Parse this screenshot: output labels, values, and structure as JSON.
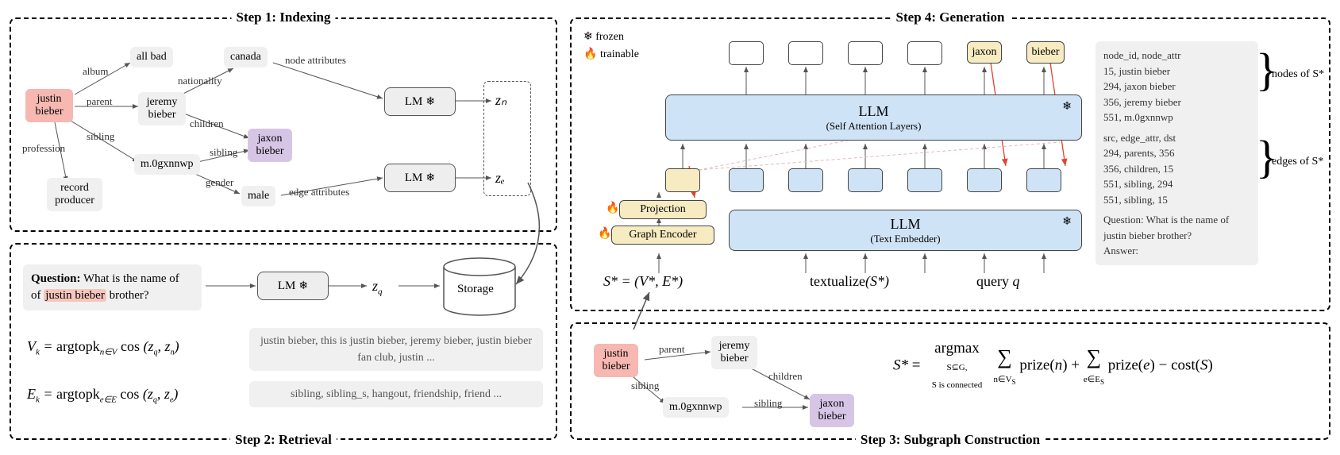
{
  "steps": {
    "s1": "Step 1: Indexing",
    "s2": "Step 2: Retrieval",
    "s3": "Step 3: Subgraph Construction",
    "s4": "Step 4: Generation"
  },
  "legend": {
    "frozen": "frozen",
    "trainable": "trainable"
  },
  "s1": {
    "nodes": {
      "justin": "justin\nbieber",
      "allbad": "all bad",
      "jeremy": "jeremy\nbieber",
      "canada": "canada",
      "jaxon": "jaxon\nbieber",
      "m0": "m.0gxnnwp",
      "record": "record\nproducer",
      "male": "male"
    },
    "edges": {
      "album": "album",
      "parent": "parent",
      "profession": "profession",
      "sibling": "sibling",
      "nationality": "nationality",
      "children": "children",
      "gender": "gender",
      "nodeattr": "node attributes",
      "edgeattr": "edge attributes"
    },
    "lm": "LM",
    "zn": "zₙ",
    "ze": "zₑ"
  },
  "s2": {
    "question_label": "Question:",
    "question_text": " What is the name of ",
    "question_ent": "justin bieber",
    "question_tail": " brother?",
    "lm": "LM",
    "zq": "z_q",
    "storage": "Storage",
    "eq_vk_l": "Vₖ = argtopk",
    "eq_vk_sub": "n∈V",
    "eq_vk_r": " cos (z_q, zₙ)",
    "eq_ek_l": "Eₖ = argtopk",
    "eq_ek_sub": "e∈E",
    "eq_ek_r": " cos (z_q, zₑ)",
    "vk_list": "justin bieber, this is justin bieber, jeremy bieber, justin bieber fan club, justin ...",
    "ek_list": "sibling, sibling_s, hangout, friendship, friend ..."
  },
  "s3": {
    "justin": "justin\nbieber",
    "jeremy": "jeremy\nbieber",
    "m0": "m.0gxnnwp",
    "jaxon": "jaxon\nbieber",
    "parent": "parent",
    "sibling": "sibling",
    "children": "children",
    "eq1": "S* = ",
    "eq_argmax": "argmax",
    "eq_sub": "S⊆G,  S is connected",
    "eq_sum1": "∑",
    "eq_sum1_sub": "n∈V_S",
    "eq_pr_n": " prize(n) + ",
    "eq_sum2": "∑",
    "eq_sum2_sub": "e∈E_S",
    "eq_pr_e": " prize(e) − cost(S)"
  },
  "s4": {
    "llm": "LLM",
    "sa": "(Self Attention Layers)",
    "te": "(Text Embedder)",
    "projection": "Projection",
    "ge": "Graph Encoder",
    "out_jaxon": "jaxon",
    "out_bieber": "bieber",
    "Sstar": "S* = (V*, E*)",
    "textualize": "textualize(S*)",
    "query": "query q",
    "nodes_header": "node_id, node_attr",
    "nodes": [
      "15, justin bieber",
      "294, jaxon bieber",
      "356, jeremy bieber",
      "551, m.0gxnnwp"
    ],
    "edges_header": "src, edge_attr, dst",
    "edges": [
      "294, parents, 356",
      "356, children, 15",
      "551, sibling, 294",
      "551, sibling, 15"
    ],
    "q_label": "Question: What is the name of justin bieber brother?",
    "answer": "Answer:",
    "nodes_of": "nodes of S*",
    "edges_of": "edges of S*"
  }
}
